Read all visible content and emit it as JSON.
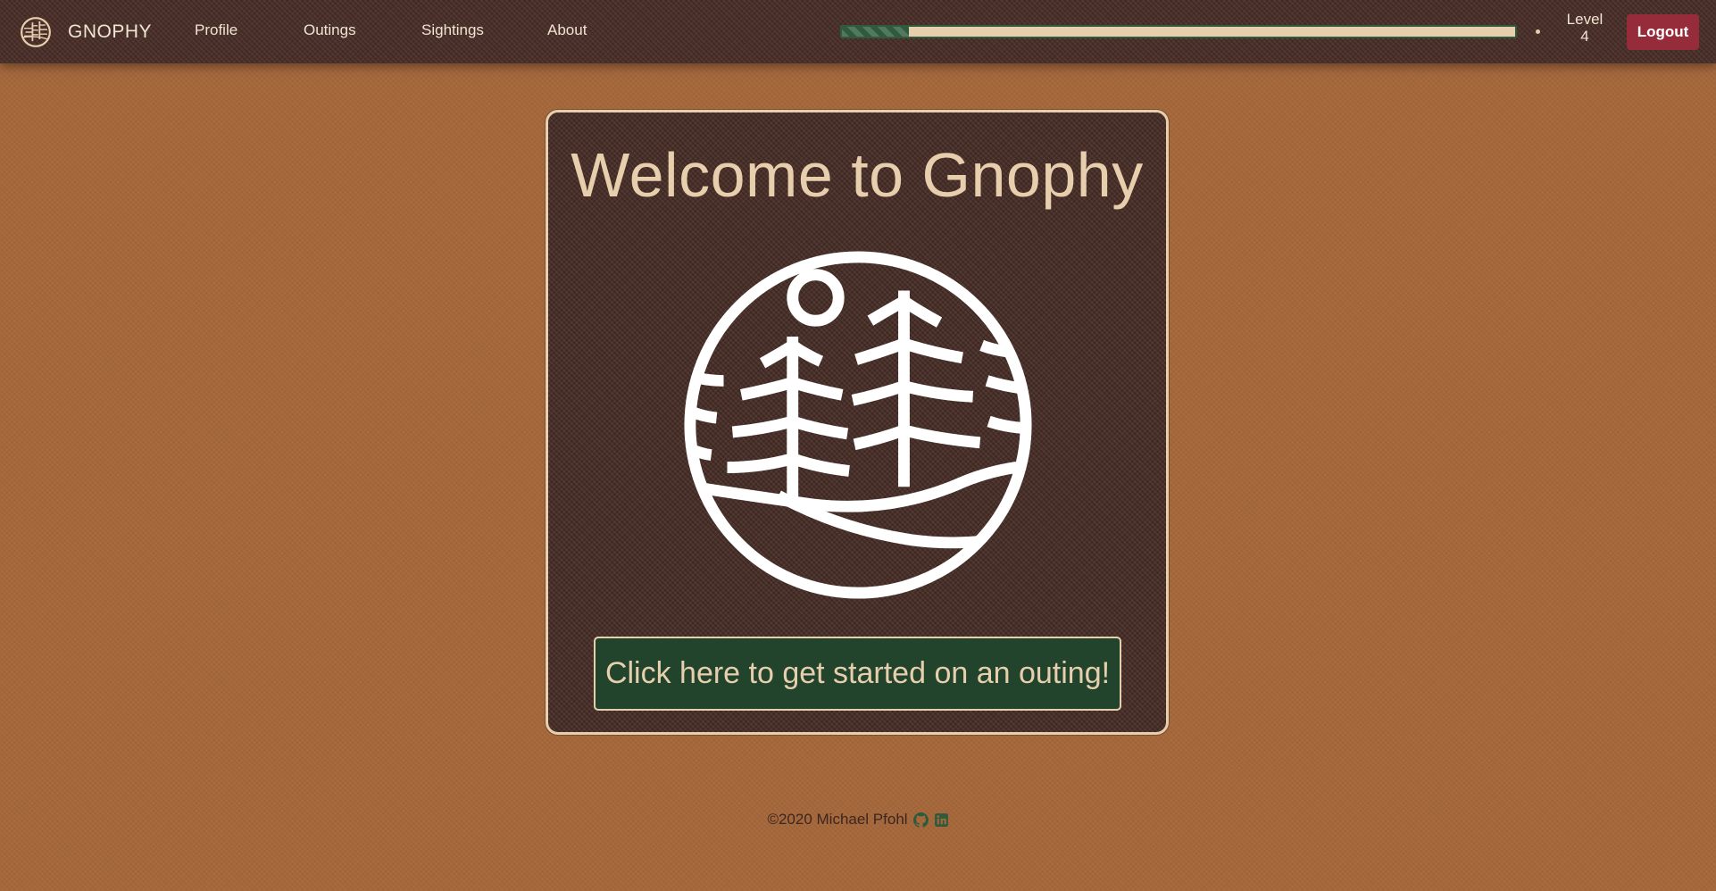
{
  "nav": {
    "brand": "GNOPHY",
    "links": [
      "Profile",
      "Outings",
      "Sightings",
      "About"
    ],
    "progress": 0.1,
    "level_label": "Level",
    "level_value": "4",
    "logout_label": "Logout"
  },
  "main": {
    "title": "Welcome to Gnophy",
    "cta_label": "Click here to get started on an outing!"
  },
  "footer": {
    "text": "©2020 Michael Pfohl",
    "icons": [
      "github-icon",
      "linkedin-icon"
    ]
  },
  "colors": {
    "page_bg": "#a6673a",
    "panel_bg": "#4a2f28",
    "cream": "#e7cfae",
    "green": "#23442c",
    "logout_red": "#962c3a"
  }
}
